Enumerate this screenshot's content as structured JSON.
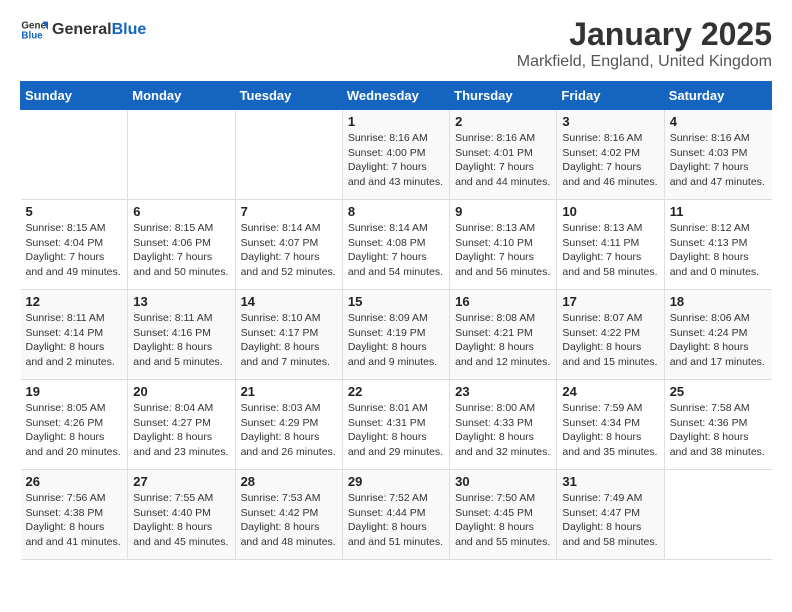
{
  "logo": {
    "text_general": "General",
    "text_blue": "Blue"
  },
  "title": "January 2025",
  "subtitle": "Markfield, England, United Kingdom",
  "days_of_week": [
    "Sunday",
    "Monday",
    "Tuesday",
    "Wednesday",
    "Thursday",
    "Friday",
    "Saturday"
  ],
  "weeks": [
    [
      {
        "day": "",
        "info": ""
      },
      {
        "day": "",
        "info": ""
      },
      {
        "day": "",
        "info": ""
      },
      {
        "day": "1",
        "info": "Sunrise: 8:16 AM\nSunset: 4:00 PM\nDaylight: 7 hours and 43 minutes."
      },
      {
        "day": "2",
        "info": "Sunrise: 8:16 AM\nSunset: 4:01 PM\nDaylight: 7 hours and 44 minutes."
      },
      {
        "day": "3",
        "info": "Sunrise: 8:16 AM\nSunset: 4:02 PM\nDaylight: 7 hours and 46 minutes."
      },
      {
        "day": "4",
        "info": "Sunrise: 8:16 AM\nSunset: 4:03 PM\nDaylight: 7 hours and 47 minutes."
      }
    ],
    [
      {
        "day": "5",
        "info": "Sunrise: 8:15 AM\nSunset: 4:04 PM\nDaylight: 7 hours and 49 minutes."
      },
      {
        "day": "6",
        "info": "Sunrise: 8:15 AM\nSunset: 4:06 PM\nDaylight: 7 hours and 50 minutes."
      },
      {
        "day": "7",
        "info": "Sunrise: 8:14 AM\nSunset: 4:07 PM\nDaylight: 7 hours and 52 minutes."
      },
      {
        "day": "8",
        "info": "Sunrise: 8:14 AM\nSunset: 4:08 PM\nDaylight: 7 hours and 54 minutes."
      },
      {
        "day": "9",
        "info": "Sunrise: 8:13 AM\nSunset: 4:10 PM\nDaylight: 7 hours and 56 minutes."
      },
      {
        "day": "10",
        "info": "Sunrise: 8:13 AM\nSunset: 4:11 PM\nDaylight: 7 hours and 58 minutes."
      },
      {
        "day": "11",
        "info": "Sunrise: 8:12 AM\nSunset: 4:13 PM\nDaylight: 8 hours and 0 minutes."
      }
    ],
    [
      {
        "day": "12",
        "info": "Sunrise: 8:11 AM\nSunset: 4:14 PM\nDaylight: 8 hours and 2 minutes."
      },
      {
        "day": "13",
        "info": "Sunrise: 8:11 AM\nSunset: 4:16 PM\nDaylight: 8 hours and 5 minutes."
      },
      {
        "day": "14",
        "info": "Sunrise: 8:10 AM\nSunset: 4:17 PM\nDaylight: 8 hours and 7 minutes."
      },
      {
        "day": "15",
        "info": "Sunrise: 8:09 AM\nSunset: 4:19 PM\nDaylight: 8 hours and 9 minutes."
      },
      {
        "day": "16",
        "info": "Sunrise: 8:08 AM\nSunset: 4:21 PM\nDaylight: 8 hours and 12 minutes."
      },
      {
        "day": "17",
        "info": "Sunrise: 8:07 AM\nSunset: 4:22 PM\nDaylight: 8 hours and 15 minutes."
      },
      {
        "day": "18",
        "info": "Sunrise: 8:06 AM\nSunset: 4:24 PM\nDaylight: 8 hours and 17 minutes."
      }
    ],
    [
      {
        "day": "19",
        "info": "Sunrise: 8:05 AM\nSunset: 4:26 PM\nDaylight: 8 hours and 20 minutes."
      },
      {
        "day": "20",
        "info": "Sunrise: 8:04 AM\nSunset: 4:27 PM\nDaylight: 8 hours and 23 minutes."
      },
      {
        "day": "21",
        "info": "Sunrise: 8:03 AM\nSunset: 4:29 PM\nDaylight: 8 hours and 26 minutes."
      },
      {
        "day": "22",
        "info": "Sunrise: 8:01 AM\nSunset: 4:31 PM\nDaylight: 8 hours and 29 minutes."
      },
      {
        "day": "23",
        "info": "Sunrise: 8:00 AM\nSunset: 4:33 PM\nDaylight: 8 hours and 32 minutes."
      },
      {
        "day": "24",
        "info": "Sunrise: 7:59 AM\nSunset: 4:34 PM\nDaylight: 8 hours and 35 minutes."
      },
      {
        "day": "25",
        "info": "Sunrise: 7:58 AM\nSunset: 4:36 PM\nDaylight: 8 hours and 38 minutes."
      }
    ],
    [
      {
        "day": "26",
        "info": "Sunrise: 7:56 AM\nSunset: 4:38 PM\nDaylight: 8 hours and 41 minutes."
      },
      {
        "day": "27",
        "info": "Sunrise: 7:55 AM\nSunset: 4:40 PM\nDaylight: 8 hours and 45 minutes."
      },
      {
        "day": "28",
        "info": "Sunrise: 7:53 AM\nSunset: 4:42 PM\nDaylight: 8 hours and 48 minutes."
      },
      {
        "day": "29",
        "info": "Sunrise: 7:52 AM\nSunset: 4:44 PM\nDaylight: 8 hours and 51 minutes."
      },
      {
        "day": "30",
        "info": "Sunrise: 7:50 AM\nSunset: 4:45 PM\nDaylight: 8 hours and 55 minutes."
      },
      {
        "day": "31",
        "info": "Sunrise: 7:49 AM\nSunset: 4:47 PM\nDaylight: 8 hours and 58 minutes."
      },
      {
        "day": "",
        "info": ""
      }
    ]
  ]
}
